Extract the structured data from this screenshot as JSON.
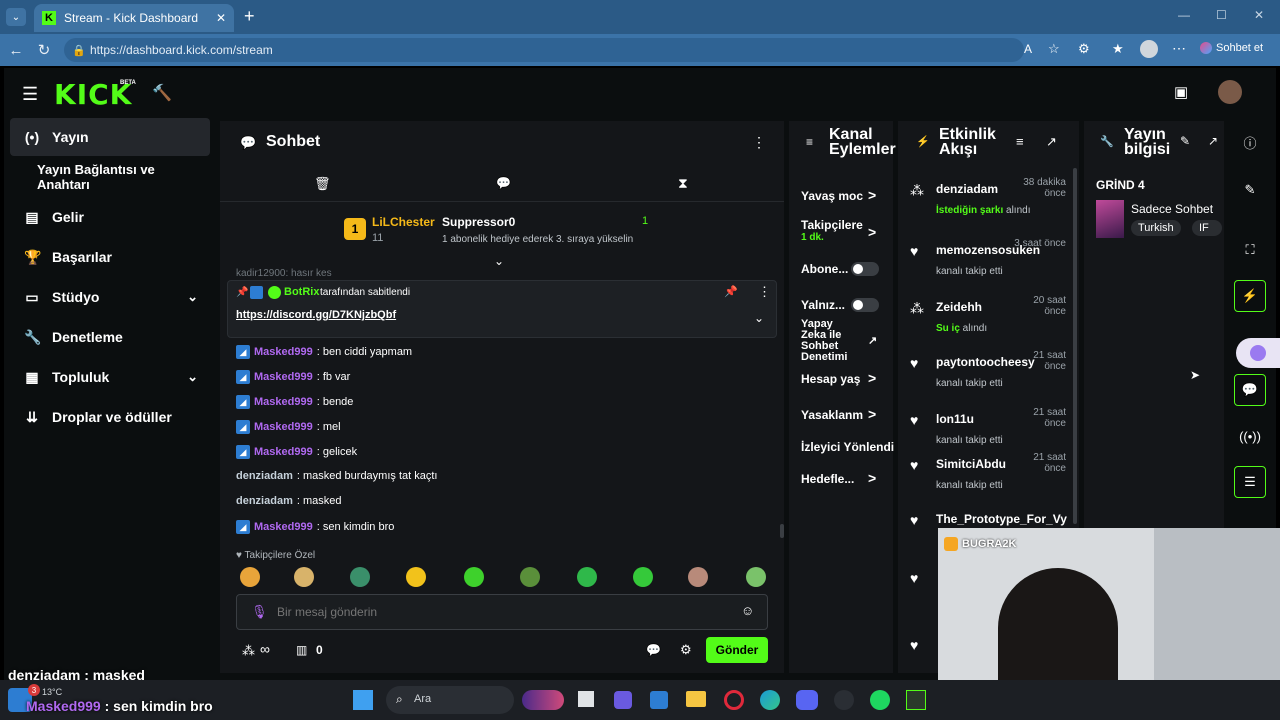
{
  "browser": {
    "tab_title": "Stream - Kick Dashboard",
    "url": "https://dashboard.kick.com/stream",
    "chat_button": "Sohbet et"
  },
  "header": {
    "logo": "KICK",
    "beta": "BETA"
  },
  "sidebar": {
    "items": [
      {
        "label": "Yayın",
        "icon": "stream-icon"
      },
      {
        "label": "Yayın Bağlantısı ve Anahtarı",
        "icon": ""
      },
      {
        "label": "Gelir",
        "icon": "money-icon"
      },
      {
        "label": "Başarılar",
        "icon": "trophy-icon"
      },
      {
        "label": "Stüdyo",
        "icon": "studio-icon"
      },
      {
        "label": "Denetleme",
        "icon": "wrench-icon"
      },
      {
        "label": "Topluluk",
        "icon": "community-icon"
      },
      {
        "label": "Droplar ve ödüller",
        "icon": "drops-icon"
      }
    ]
  },
  "chat": {
    "title": "Sohbet",
    "leader": {
      "name": "LiLChester",
      "count": "11",
      "rank": "1"
    },
    "gifter": {
      "name": "Suppressor0",
      "text": "1 abonelik hediye ederek 3. sıraya yükselin",
      "count": "1"
    },
    "peek_row": "kadir12900: hasır kes",
    "pinned": {
      "user": "BotRix",
      "suffix": "tarafından sabitlendi",
      "link": "https://discord.gg/D7KNjzbQbf"
    },
    "messages": [
      {
        "user": "Masked999",
        "text": ": ben ciddi yapmam",
        "badge": true
      },
      {
        "user": "Masked999",
        "text": ": fb var",
        "badge": true
      },
      {
        "user": "Masked999",
        "text": ": bende",
        "badge": true
      },
      {
        "user": "Masked999",
        "text": ": mel",
        "badge": true
      },
      {
        "user": "Masked999",
        "text": ": gelicek",
        "badge": true
      },
      {
        "user": "denziadam",
        "text": ": masked burdaymış tat kaçtı",
        "badge": false
      },
      {
        "user": "denziadam",
        "text": ": masked",
        "badge": false
      },
      {
        "user": "Masked999",
        "text": ": sen kimdin bro",
        "badge": true
      }
    ],
    "followers_only": "Takipçilere Özel",
    "input_placeholder": "Bir mesaj gönderin",
    "points": "∞",
    "gift_count": "0",
    "send_label": "Gönder"
  },
  "actions": {
    "title_line1": "Kanal",
    "title_line2": "Eylemler",
    "rows": [
      {
        "label": "Yavaş moc"
      },
      {
        "label": "Takipçilere",
        "sub": "1 dk."
      },
      {
        "label": "Abone..."
      },
      {
        "label": "Yalnız..."
      },
      {
        "label": "Yapay Zeka ile Sohbet Denetimi"
      },
      {
        "label": "Hesap yaş"
      },
      {
        "label": "Yasaklanm"
      },
      {
        "label": "İzleyici Yönlendi"
      },
      {
        "label": "Hedefle..."
      }
    ]
  },
  "feed": {
    "title_line1": "Etkinlik",
    "title_line2": "Akışı",
    "items": [
      {
        "name": "denziadam",
        "time": "38 dakika önce",
        "sub_hl": "İstediğin şarkı",
        "sub": " alındı",
        "icon": "points-icon"
      },
      {
        "name": "memozensosuken",
        "time": "3 saat önce",
        "sub": "kanalı takip etti",
        "icon": "heart-icon"
      },
      {
        "name": "Zeidehh",
        "time": "20 saat önce",
        "sub_hl": "Su iç",
        "sub": " alındı",
        "icon": "points-icon"
      },
      {
        "name": "paytontoocheesy",
        "time": "21 saat önce",
        "sub": "kanalı takip etti",
        "icon": "heart-icon"
      },
      {
        "name": "lon11u",
        "time": "21 saat önce",
        "sub": "kanalı takip etti",
        "icon": "heart-icon"
      },
      {
        "name": "SimitciAbdu",
        "time": "21 saat önce",
        "sub": "kanalı takip etti",
        "icon": "heart-icon"
      },
      {
        "name": "The_Prototype_For_Vy",
        "time": "",
        "sub": "",
        "icon": "heart-icon"
      }
    ]
  },
  "info": {
    "title_line1": "Yayın",
    "title_line2": "bilgisi",
    "stream_title": "GRİND 4",
    "category": "Sadece Sohbet",
    "tags": [
      "Turkish",
      "IF"
    ]
  },
  "overlay": {
    "line1_user": "denziadam",
    "line1_text": " : masked",
    "line2_user": "Masked999",
    "line2_text": " : sen kimdin bro",
    "temp": "13°C",
    "cam_label": "BUGRA2K"
  },
  "taskbar": {
    "search": "Ara"
  }
}
